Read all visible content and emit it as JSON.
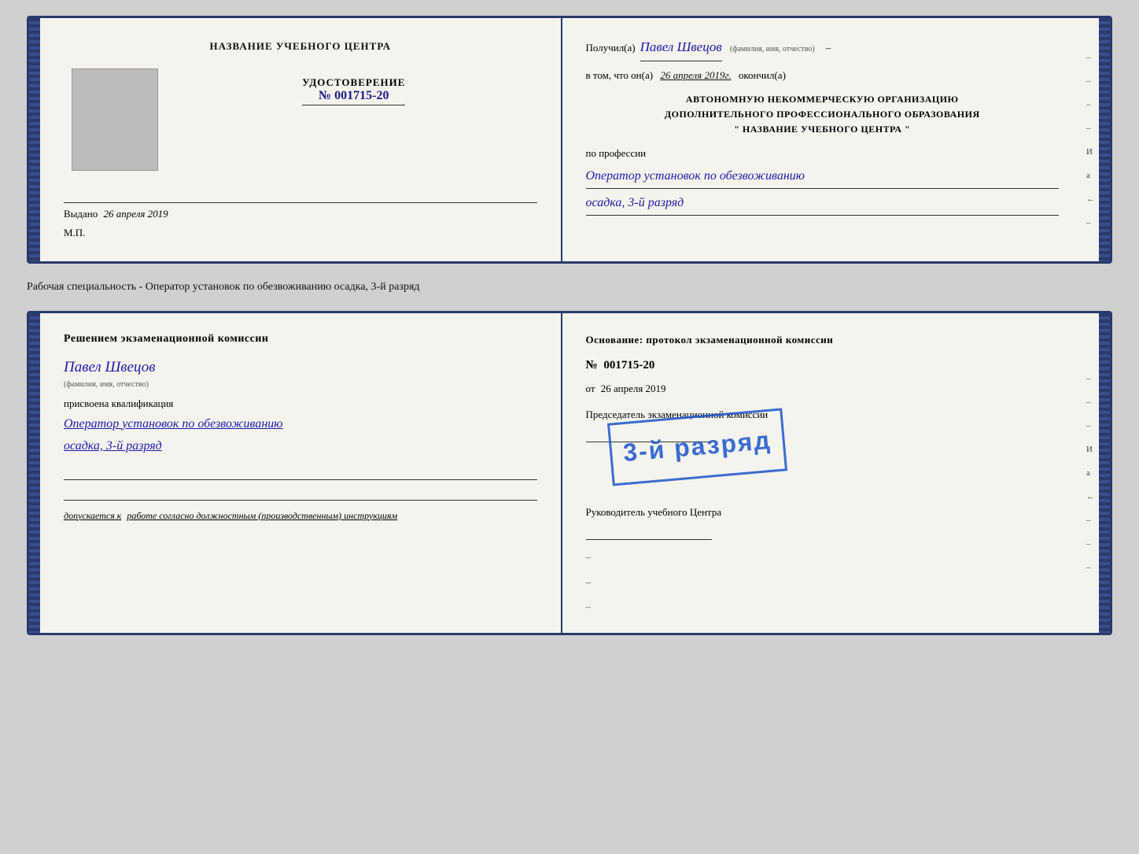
{
  "doc1": {
    "left": {
      "center_title": "НАЗВАНИЕ УЧЕБНОГО ЦЕНТРА",
      "udostoverenie_label": "УДОСТОВЕРЕНИЕ",
      "number_prefix": "№",
      "number": "001715-20",
      "vydano_label": "Выдано",
      "vydano_date": "26 апреля 2019",
      "mp": "М.П."
    },
    "right": {
      "poluchil_prefix": "Получил(а)",
      "recipient_name": "Павел Швецов",
      "fio_label": "(фамилия, имя, отчество)",
      "dash1": "–",
      "vtom_prefix": "в том, что он(а)",
      "vtom_date": "26 апреля 2019г.",
      "okончил": "окончил(а)",
      "org_line1": "АВТОНОМНУЮ НЕКОММЕРЧЕСКУЮ ОРГАНИЗАЦИЮ",
      "org_line2": "ДОПОЛНИТЕЛЬНОГО ПРОФЕССИОНАЛЬНОГО ОБРАЗОВАНИЯ",
      "org_line3": "\"   НАЗВАНИЕ УЧЕБНОГО ЦЕНТРА   \"",
      "po_professii": "по профессии",
      "profession1": "Оператор установок по обезвоживанию",
      "profession2": "осадка, 3-й разряд"
    }
  },
  "caption": "Рабочая специальность - Оператор установок по обезвоживанию осадка, 3-й разряд",
  "doc2": {
    "left": {
      "resheniem_title": "Решением экзаменационной комиссии",
      "name": "Павел Швецов",
      "fio_label": "(фамилия, имя, отчество)",
      "prisvoena": "присвоена квалификация",
      "qualification1": "Оператор установок по обезвоживанию",
      "qualification2": "осадка, 3-й разряд",
      "dopuskaetsya_prefix": "допускается к",
      "dopuskaetsya_text": "работе согласно должностным (производственным) инструкциям"
    },
    "right": {
      "osnovanie": "Основание: протокол экзаменационной комиссии",
      "number_prefix": "№",
      "number": "001715-20",
      "ot_prefix": "от",
      "ot_date": "26 апреля 2019",
      "predsedatel_label": "Председатель экзаменационной комиссии",
      "stamp_text": "3-й разряд",
      "rukovoditel_label": "Руководитель учебного Центра"
    },
    "right_edge": {
      "chars": [
        "–",
        "–",
        "–",
        "И",
        "а",
        "←",
        "–",
        "–",
        "–"
      ]
    }
  },
  "doc1_right_edge": {
    "chars": [
      "–",
      "–",
      "–",
      "–",
      "И",
      "а",
      "←",
      "–"
    ]
  }
}
